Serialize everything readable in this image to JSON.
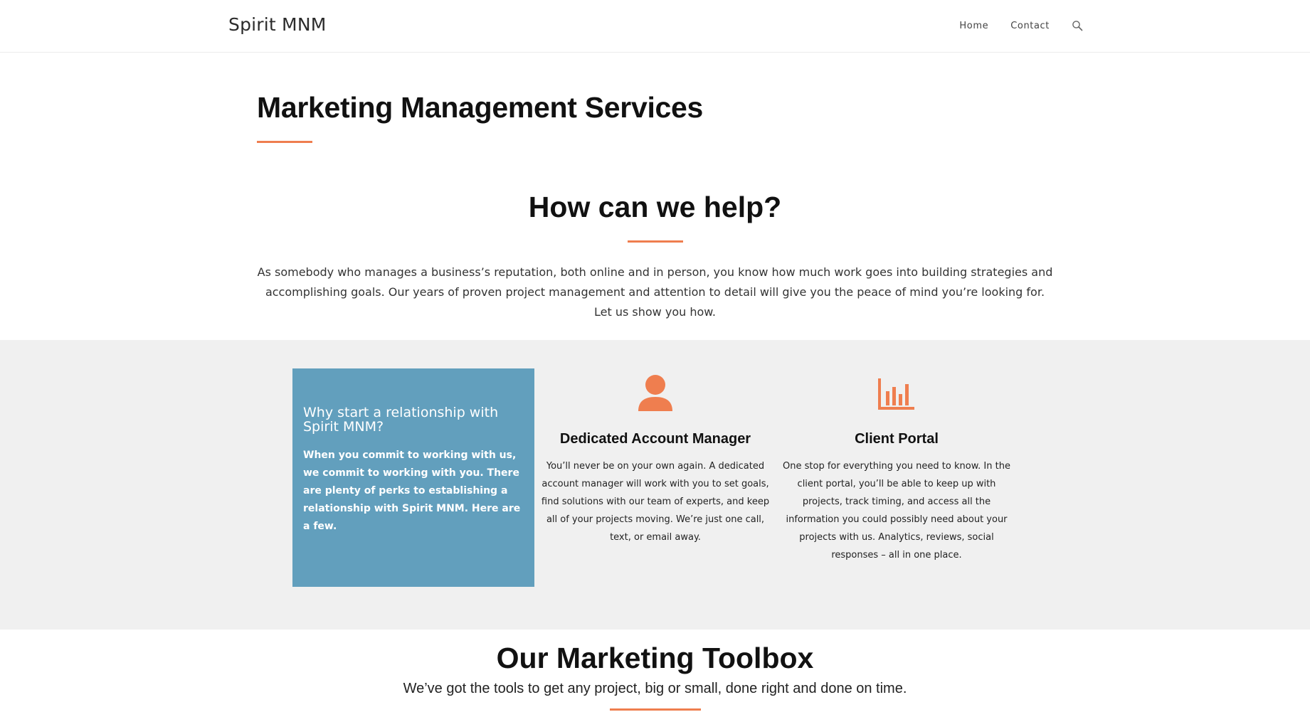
{
  "header": {
    "brand": "Spirit MNM",
    "nav": {
      "home": "Home",
      "contact": "Contact",
      "search_icon": "search-icon"
    }
  },
  "page": {
    "title": "Marketing Management Services"
  },
  "help": {
    "heading": "How can we help?",
    "body": "As somebody who manages a business’s reputation, both online and in person, you know how much work goes into building strategies and accomplishing goals. Our years of proven project management and attention to detail will give you the peace of mind you’re looking for. Let us show you how."
  },
  "features": {
    "card": {
      "heading": "Why start a relationship with Spirit MNM?",
      "body": "When you commit to working with us, we commit to working with you. There are plenty of perks to establishing a relationship with Spirit MNM. Here are a few."
    },
    "account_manager": {
      "icon": "user-icon",
      "title": "Dedicated Account Manager",
      "body": "You’ll never be on your own again. A dedicated account manager will work with you to set goals, find solutions with our team of experts, and keep all of your projects moving. We’re just one call, text, or email away."
    },
    "client_portal": {
      "icon": "bar-chart-icon",
      "title": "Client Portal",
      "body": "One stop for everything you need to know. In the client portal, you’ll be able to keep up with projects, track timing, and access all the information you could possibly need about your projects with us. Analytics, reviews, social responses – all in one place."
    }
  },
  "toolbox": {
    "heading": "Our Marketing Toolbox",
    "subheading": "We’ve got the tools to get any project, big or small, done right and done on time."
  },
  "colors": {
    "accent": "#ef7e4f",
    "card_blue": "#629fbd",
    "band_gray": "#f0f0f0"
  }
}
